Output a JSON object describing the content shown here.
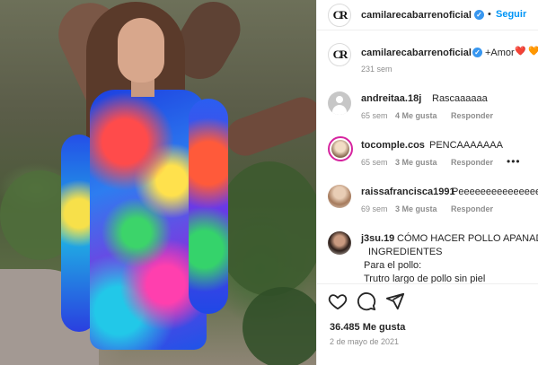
{
  "header": {
    "username": "camilarecabarrenoficial",
    "avatar_text": "CR",
    "follow_label": "Seguir",
    "separator": "•"
  },
  "caption": {
    "username": "camilarecabarrenoficial",
    "text": "+Amor",
    "emojis": "❤️ 🧡",
    "time": "231 sem"
  },
  "comments": [
    {
      "username": "andreitaa.18j",
      "text": "Rascaaaaaa",
      "time": "65 sem",
      "likes": "4 Me gusta",
      "reply": "Responder"
    },
    {
      "username": "tocomple.cos",
      "text": "PENCAAAAAAA",
      "time": "65 sem",
      "likes": "3 Me gusta",
      "reply": "Responder",
      "more": "•••"
    },
    {
      "username": "raissafrancisca1991",
      "text": "Peeeeeeeeeeeeeeeeeeeeeeeeeee",
      "time": "69 sem",
      "likes": "3 Me gusta",
      "reply": "Responder"
    },
    {
      "username": "j3su.19",
      "text": "CÓMO HACER POLLO APANADO",
      "lines": [
        "INGREDIENTES",
        "Para el pollo:",
        "Trutro largo de pollo sin piel"
      ]
    }
  ],
  "actions": {
    "icons": [
      "heart-icon",
      "comment-icon",
      "share-icon"
    ],
    "likes": "36.485 Me gusta",
    "date": "2 de mayo de 2021"
  },
  "colors": {
    "verified": "#3897f0",
    "follow": "#0095f6",
    "muted": "#8e8e8e",
    "heart_red": "#ed4956",
    "heart_orange": "#f77737"
  }
}
